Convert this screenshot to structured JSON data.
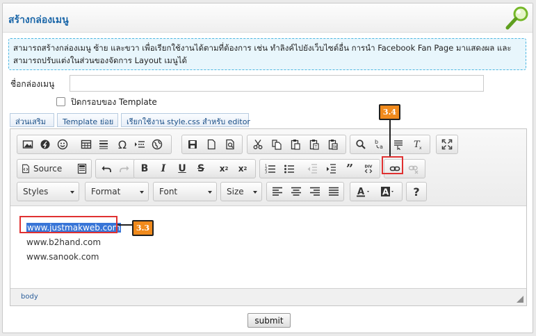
{
  "header": {
    "title": "สร้างกล่องเมนู",
    "icon": "magnifier-icon"
  },
  "info": {
    "text": "สามารถสร้างกล่องเมนู ซ้าย และขวา เพื่อเรียกใช้งานได้ตามที่ต้องการ เช่น ทำลิงค์ไปยังเว็บไซต์อื่น การนำ Facebook Fan Page มาแสดงผล และสามารถปรับแต่งในส่วนของจัดการ Layout เมนูได้"
  },
  "form": {
    "menu_name_label": "ชื่อกล่องเมนู",
    "menu_name_value": "",
    "hide_template_label": "ปิดกรอบของ Template",
    "hide_template_checked": false
  },
  "tabs": [
    {
      "label": "ส่วนเสริม"
    },
    {
      "label": "Template ย่อย"
    },
    {
      "label": "เรียกใช้งาน style.css สำหรับ editor"
    }
  ],
  "toolbar": {
    "source_label": "Source",
    "styles_label": "Styles",
    "format_label": "Format",
    "font_label": "Font",
    "size_label": "Size",
    "help_label": "?"
  },
  "editor_content": {
    "lines": [
      "www.justmakweb.com",
      "www.b2hand.com",
      "www.sanook.com"
    ],
    "selected_line": 0
  },
  "status": {
    "path": "body"
  },
  "annotations": {
    "callout_link": "3.4",
    "callout_selection": "3.3",
    "accent": "#f08a1c",
    "highlight": "#e03131"
  },
  "submit_label": "submit"
}
